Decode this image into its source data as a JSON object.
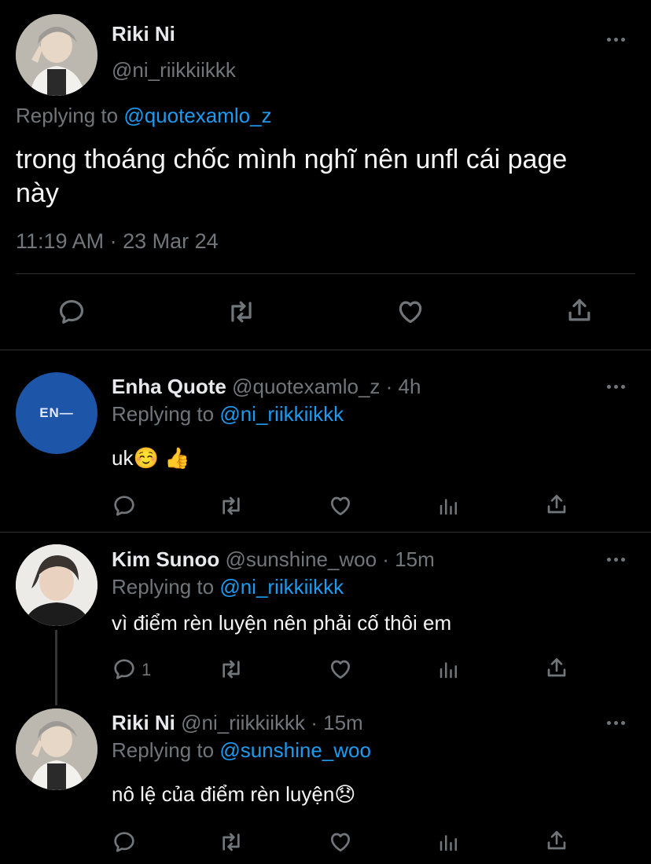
{
  "main_tweet": {
    "name": "Riki Ni",
    "handle": "@ni_riikkiikkk",
    "replying_prefix": "Replying to",
    "replying_handle": "@quotexamlo_z",
    "text_line1": "trong thoáng chốc mình nghĩ nên unfl cái page",
    "text_line2": "này",
    "timestamp": "11:19 AM · 23 Mar 24"
  },
  "replies": [
    {
      "name": "Enha Quote",
      "meta": "@quotexamlo_z · 4h",
      "replying_prefix": "Replying to",
      "replying_handle": "@ni_riikkiikkk",
      "text": "uk☺️ 👍",
      "avatar_text": "EN—",
      "reply_count": ""
    },
    {
      "name": "Kim Sunoo",
      "meta": "@sunshine_woo · 15m",
      "replying_prefix": "Replying to",
      "replying_handle": "@ni_riikkiikkk",
      "text": "vì điểm rèn luyện nên phải cố thôi em",
      "reply_count": "1"
    },
    {
      "name": "Riki Ni",
      "meta": "@ni_riikkiikkk · 15m",
      "replying_prefix": "Replying to",
      "replying_handle": "@sunshine_woo",
      "text": "nô lệ của điểm rèn luyện😞",
      "reply_count": ""
    }
  ],
  "colors": {
    "background": "#000000",
    "text": "#e7e9ea",
    "secondary": "#71767b",
    "link": "#1d9bf0",
    "divider": "#2f3336",
    "enha_avatar": "#1d56a8"
  }
}
